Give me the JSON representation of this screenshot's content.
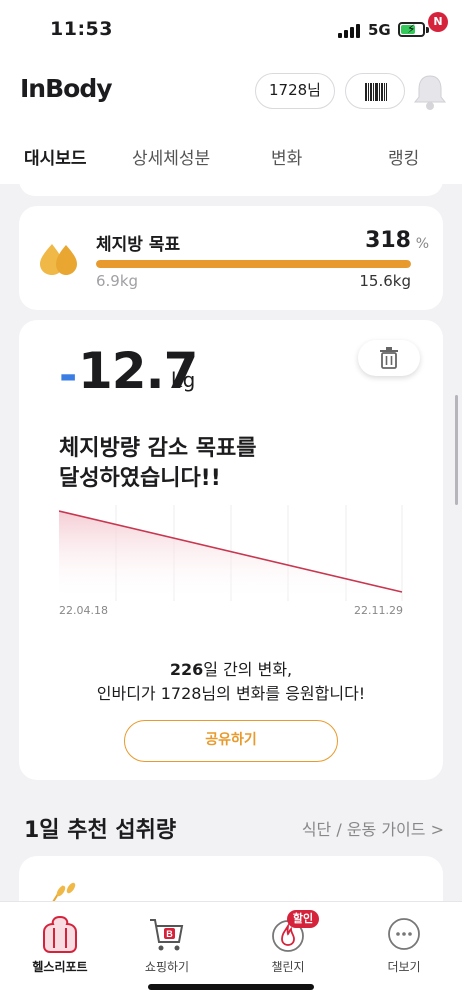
{
  "status": {
    "time": "11:53",
    "network": "5G"
  },
  "header": {
    "logo": "InBody",
    "user": "1728님"
  },
  "notification": {
    "badge": "N"
  },
  "tabs": [
    {
      "label": "대시보드",
      "active": true
    },
    {
      "label": "상세체성분",
      "active": false
    },
    {
      "label": "변화",
      "active": false
    },
    {
      "label": "랭킹",
      "active": false
    }
  ],
  "goal": {
    "title": "체지방 목표",
    "percent": "318",
    "percent_sign": "%",
    "start": "6.9kg",
    "end": "15.6kg",
    "progress_fraction": 1.0
  },
  "achievement": {
    "sign": "-",
    "value": "12.7",
    "unit": "kg",
    "line1": "체지방량 감소 목표를",
    "line2": "달성하였습니다!!",
    "start_date": "22.04.18",
    "end_date": "22.11.29",
    "days": "226",
    "summary_suffix": "일 간의 변화,",
    "summary2": "인바디가 1728님의 변화를 응원합니다!",
    "share_label": "공유하기"
  },
  "intake": {
    "title": "1일 추천 섭취량",
    "guide_link": "식단 / 운동 가이드 >"
  },
  "bottom_nav": [
    {
      "label": "헬스리포트",
      "active": true
    },
    {
      "label": "쇼핑하기",
      "active": false
    },
    {
      "label": "챌린지",
      "active": false,
      "badge": "할인"
    },
    {
      "label": "더보기",
      "active": false
    }
  ],
  "colors": {
    "accent": "#e89a2c",
    "brand_red": "#d6233c",
    "trend_line": "#c8374f",
    "blue": "#3a7ee4"
  }
}
